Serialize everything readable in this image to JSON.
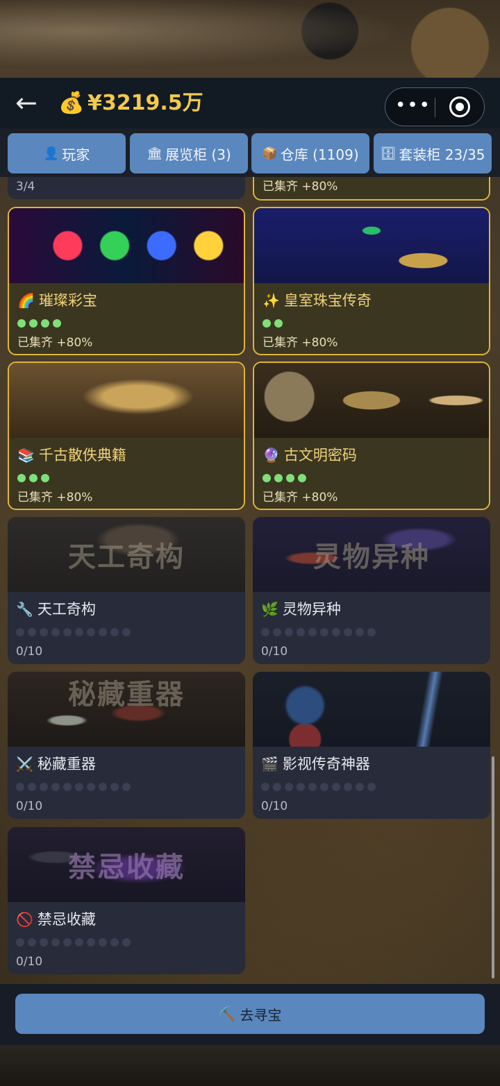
{
  "header": {
    "back_icon": "←",
    "money_icon": "💰",
    "money": "¥3219.5万",
    "more_icon": "•••"
  },
  "tabs": [
    {
      "icon": "👤",
      "label": "玩家"
    },
    {
      "icon": "🏛",
      "label": "展览柜 (3)"
    },
    {
      "icon": "📦",
      "label": "仓库 (1109)"
    },
    {
      "icon": "🗄",
      "label": "套装柜 23/35"
    }
  ],
  "partial_cards": [
    {
      "status": "3/4"
    },
    {
      "status": "已集齐 +80%"
    }
  ],
  "cards": [
    {
      "icon": "🌈",
      "title": "璀璨彩宝",
      "dots_filled": 4,
      "dots_total": 4,
      "status": "已集齐 +80%",
      "complete": true
    },
    {
      "icon": "✨",
      "title": "皇室珠宝传奇",
      "dots_filled": 2,
      "dots_total": 2,
      "status": "已集齐 +80%",
      "complete": true
    },
    {
      "icon": "📚",
      "title": "千古散佚典籍",
      "dots_filled": 3,
      "dots_total": 3,
      "status": "已集齐 +80%",
      "complete": true
    },
    {
      "icon": "🔮",
      "title": "古文明密码",
      "dots_filled": 4,
      "dots_total": 4,
      "status": "已集齐 +80%",
      "complete": true
    },
    {
      "icon": "🔧",
      "title": "天工奇构",
      "dots_filled": 0,
      "dots_total": 10,
      "status": "0/10",
      "complete": false,
      "art_text": "天工奇构"
    },
    {
      "icon": "🌿",
      "title": "灵物异种",
      "dots_filled": 0,
      "dots_total": 10,
      "status": "0/10",
      "complete": false,
      "art_text": "灵物异种"
    },
    {
      "icon": "⚔️",
      "title": "秘藏重器",
      "dots_filled": 0,
      "dots_total": 10,
      "status": "0/10",
      "complete": false,
      "art_text": "秘藏重器"
    },
    {
      "icon": "🎬",
      "title": "影视传奇神器",
      "dots_filled": 0,
      "dots_total": 10,
      "status": "0/10",
      "complete": false
    },
    {
      "icon": "🚫",
      "title": "禁忌收藏",
      "dots_filled": 0,
      "dots_total": 10,
      "status": "0/10",
      "complete": false,
      "art_text": "禁忌收藏"
    }
  ],
  "cta": {
    "icon": "⛏️",
    "label": "去寻宝"
  }
}
